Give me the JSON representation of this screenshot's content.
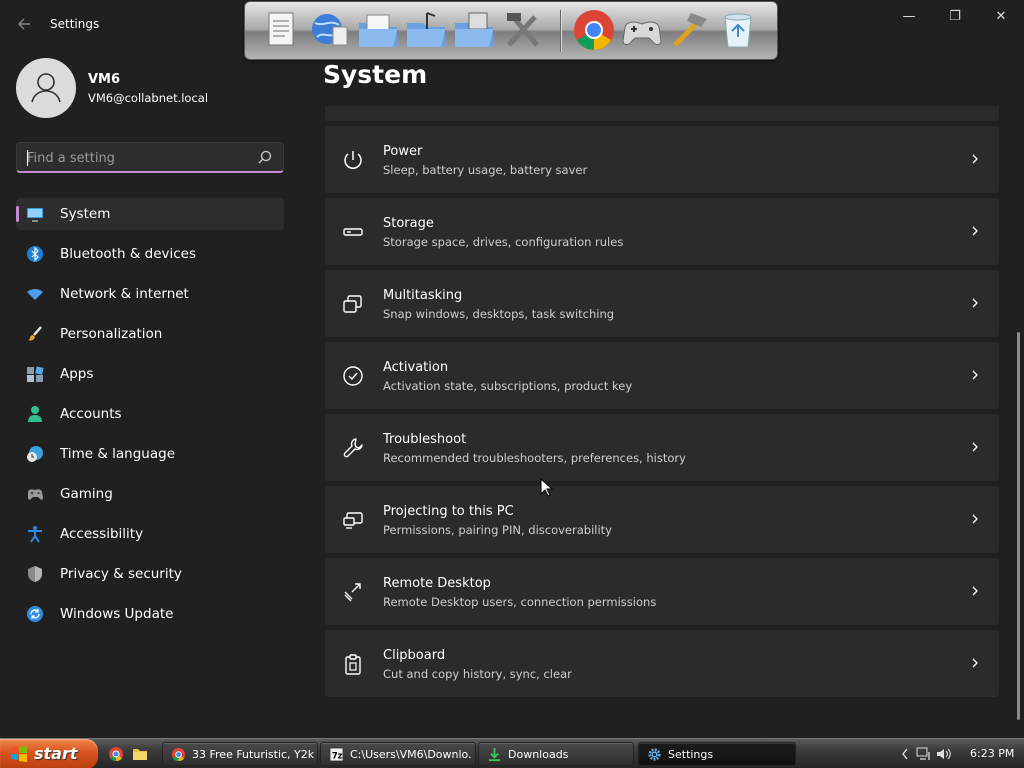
{
  "window": {
    "title": "Settings",
    "controls": {
      "minimize": "—",
      "maximize": "❐",
      "close": "✕"
    }
  },
  "user": {
    "name": "VM6",
    "email": "VM6@collabnet.local"
  },
  "search": {
    "placeholder": "Find a setting"
  },
  "nav": [
    {
      "label": "System",
      "icon": "monitor-icon",
      "color": "#3a9be0",
      "active": true
    },
    {
      "label": "Bluetooth & devices",
      "icon": "bluetooth-icon",
      "color": "#1a7fd8"
    },
    {
      "label": "Network & internet",
      "icon": "wifi-icon",
      "color": "#4a9de8"
    },
    {
      "label": "Personalization",
      "icon": "brush-icon",
      "color": "#e8a33a"
    },
    {
      "label": "Apps",
      "icon": "apps-icon",
      "color": "#8a9db0"
    },
    {
      "label": "Accounts",
      "icon": "person-icon",
      "color": "#2fbf8f"
    },
    {
      "label": "Time & language",
      "icon": "globe-clock-icon",
      "color": "#3aa0e0"
    },
    {
      "label": "Gaming",
      "icon": "gamepad-icon",
      "color": "#9a9a9a"
    },
    {
      "label": "Accessibility",
      "icon": "accessibility-icon",
      "color": "#2f8de0"
    },
    {
      "label": "Privacy & security",
      "icon": "shield-icon",
      "color": "#8a8a8a"
    },
    {
      "label": "Windows Update",
      "icon": "update-icon",
      "color": "#2f8de0"
    }
  ],
  "page": {
    "title": "System"
  },
  "settings": [
    {
      "title": "Power",
      "desc": "Sleep, battery usage, battery saver",
      "icon": "power-icon"
    },
    {
      "title": "Storage",
      "desc": "Storage space, drives, configuration rules",
      "icon": "storage-icon"
    },
    {
      "title": "Multitasking",
      "desc": "Snap windows, desktops, task switching",
      "icon": "multitasking-icon"
    },
    {
      "title": "Activation",
      "desc": "Activation state, subscriptions, product key",
      "icon": "activation-icon"
    },
    {
      "title": "Troubleshoot",
      "desc": "Recommended troubleshooters, preferences, history",
      "icon": "wrench-icon"
    },
    {
      "title": "Projecting to this PC",
      "desc": "Permissions, pairing PIN, discoverability",
      "icon": "projecting-icon"
    },
    {
      "title": "Remote Desktop",
      "desc": "Remote Desktop users, connection permissions",
      "icon": "remote-desktop-icon"
    },
    {
      "title": "Clipboard",
      "desc": "Cut and copy history, sync, clear",
      "icon": "clipboard-icon"
    }
  ],
  "taskbar": {
    "start_label": "start",
    "tasks": [
      {
        "label": "33 Free Futuristic, Y2k...",
        "icon": "chrome-icon"
      },
      {
        "label": "C:\\Users\\VM6\\Downlo...",
        "icon": "zip-icon"
      },
      {
        "label": "Downloads",
        "icon": "download-folder-icon"
      },
      {
        "label": "Settings",
        "icon": "gear-icon",
        "active": true
      }
    ],
    "clock": "6:23 PM"
  },
  "colors": {
    "accent": "#c78bd6",
    "background": "#202020",
    "card": "#2b2b2b"
  }
}
